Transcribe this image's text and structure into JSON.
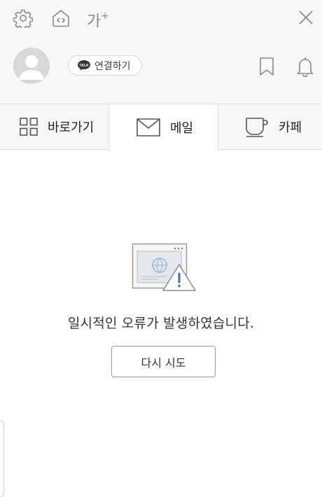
{
  "header": {
    "settings_icon": "gear-icon",
    "home_icon": "home-code-icon",
    "font_size": {
      "label": "가",
      "superscript": "+"
    },
    "close_icon": "close-icon"
  },
  "profile": {
    "avatar_icon": "user-avatar-icon",
    "connect_button": {
      "badge": "TALK",
      "label": "연결하기"
    },
    "bookmark_icon": "bookmark-icon",
    "notification_icon": "bell-icon"
  },
  "tabs": [
    {
      "label": "바로가기",
      "icon": "grid-icon",
      "active": false
    },
    {
      "label": "메일",
      "icon": "mail-icon",
      "active": true
    },
    {
      "label": "카페",
      "icon": "cup-icon",
      "active": false
    }
  ],
  "error": {
    "illustration": "browser-warning-icon",
    "message": "일시적인 오류가 발생하였습니다.",
    "retry_label": "다시 시도"
  },
  "colors": {
    "background": "#ffffff",
    "panel": "#f7f7f7",
    "icon": "#8a8a8a",
    "warning": "#2f6fd6"
  }
}
